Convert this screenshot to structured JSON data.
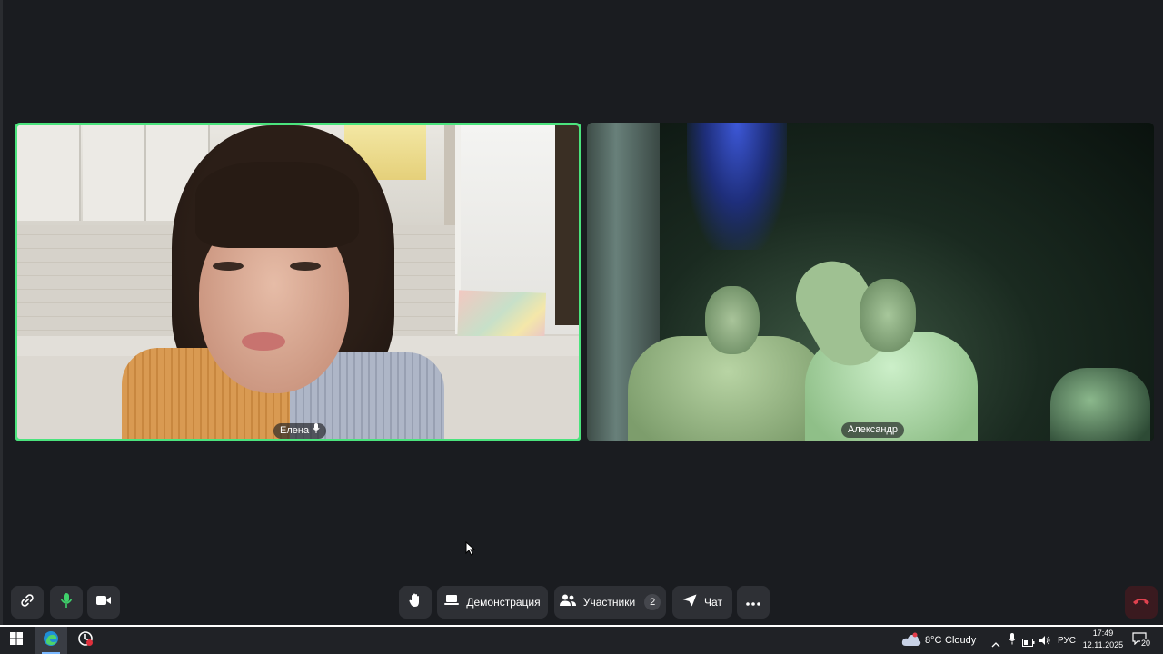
{
  "participants": [
    {
      "name": "Елена",
      "mic": "mic-on",
      "active_speaker": true
    },
    {
      "name": "Александр",
      "active_speaker": false
    }
  ],
  "controls": {
    "link_icon": "link-icon",
    "mic_icon": "mic-icon",
    "camera_icon": "camera-icon",
    "raise_hand_icon": "hand-icon",
    "screen_share_label": "Демонстрация",
    "participants_label": "Участники",
    "participants_count": "2",
    "chat_label": "Чат",
    "more_icon": "more-icon",
    "hangup_icon": "phone-hangup-icon"
  },
  "colors": {
    "active_speaker_border": "#4be37d",
    "mic_active": "#3fd16b",
    "hangup": "#e0424f"
  },
  "taskbar": {
    "weather_temp": "8°C",
    "weather_text": "Cloudy",
    "language": "РУС",
    "time": "17:49",
    "date": "12.11.2025",
    "notifications_count": "20"
  }
}
